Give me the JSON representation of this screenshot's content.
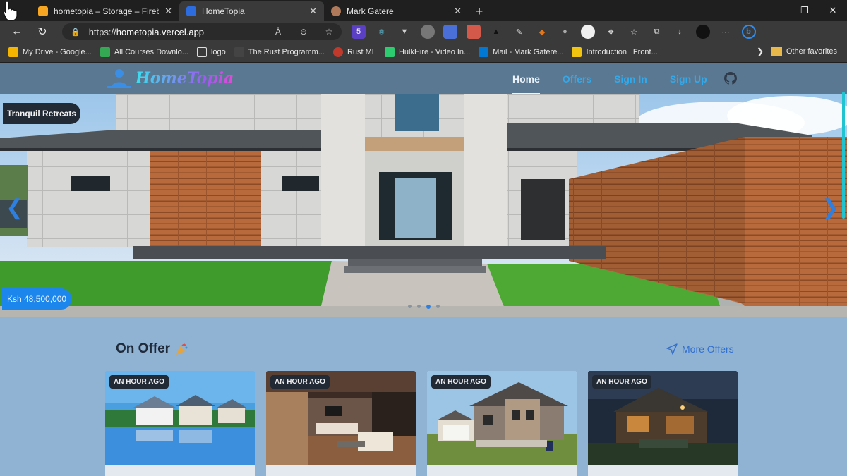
{
  "browser": {
    "tabs": [
      {
        "label": "hometopia – Storage – Firebase c",
        "active": false
      },
      {
        "label": "HomeTopia",
        "active": true
      },
      {
        "label": "Mark Gatere",
        "active": false
      }
    ],
    "new_tab": "+",
    "window_controls": {
      "minimize": "—",
      "maximize": "❐",
      "close": "✕"
    },
    "url_scheme": "https://",
    "url_host": "hometopia.vercel.app",
    "bookmarks": [
      {
        "label": "My Drive - Google...",
        "color": "#f4b400"
      },
      {
        "label": "All Courses Downlo...",
        "color": "#34a853"
      },
      {
        "label": "logo",
        "color": "#dddddd"
      },
      {
        "label": "The Rust Programm...",
        "color": "#555555"
      },
      {
        "label": "Rust ML",
        "color": "#c0392b"
      },
      {
        "label": "HulkHire - Video In...",
        "color": "#2ecc71"
      },
      {
        "label": "Mail - Mark Gatere...",
        "color": "#0078d4"
      },
      {
        "label": "Introduction | Front...",
        "color": "#f1c40f"
      }
    ],
    "other_favorites": "Other favorites"
  },
  "site": {
    "brand": "HomeTopia",
    "nav": [
      {
        "label": "Home",
        "active": true
      },
      {
        "label": "Offers",
        "active": false
      },
      {
        "label": "Sign In",
        "active": false
      },
      {
        "label": "Sign Up",
        "active": false
      }
    ],
    "hero": {
      "title": "Tranquil Retreats",
      "price": "Ksh 48,500,000",
      "slide_count": 4,
      "active_slide": 3
    },
    "offers": {
      "heading": "On Offer",
      "more_label": "More Offers",
      "cards": [
        {
          "badge": "AN HOUR AGO",
          "image": "lakeside-houses"
        },
        {
          "badge": "AN HOUR AGO",
          "image": "living-room-interior"
        },
        {
          "badge": "AN HOUR AGO",
          "image": "suburban-house"
        },
        {
          "badge": "AN HOUR AGO",
          "image": "night-house-interior"
        }
      ]
    }
  },
  "colors": {
    "header_bg": "#5a7891",
    "page_bg": "#90b2d3",
    "nav_link": "#33a9ea",
    "accent_blue": "#1c86ec"
  }
}
